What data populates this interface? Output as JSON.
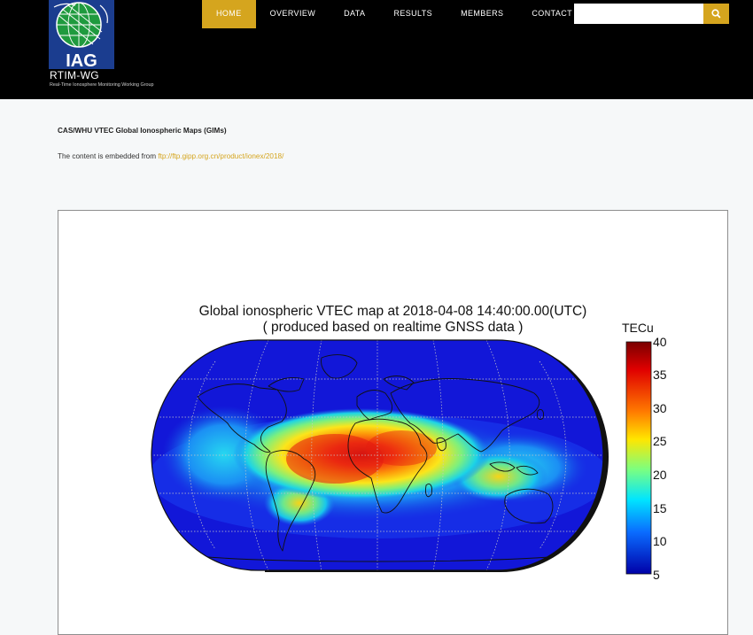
{
  "header": {
    "logo_text": "IAG",
    "site_name": "RTIM-WG",
    "tagline": "Real-Time Ionosphere Monitoring Working Group",
    "nav": [
      {
        "label": "HOME",
        "active": true
      },
      {
        "label": "OVERVIEW",
        "active": false
      },
      {
        "label": "DATA",
        "active": false
      },
      {
        "label": "RESULTS",
        "active": false
      },
      {
        "label": "MEMBERS",
        "active": false
      },
      {
        "label": "CONTACT",
        "active": false
      }
    ],
    "search": {
      "value": "",
      "icon": "search-icon"
    }
  },
  "content": {
    "heading": "CAS/WHU VTEC Global Ionospheric Maps (GIMs)",
    "embed_prefix": "The content is embedded from ",
    "embed_link": "ftp://ftp.gipp.org.cn/product/ionex/2018/"
  },
  "map": {
    "title_line1": "Global ionospheric VTEC map at 2018-04-08 14:40:00.00(UTC)",
    "title_line2": "( produced based on realtime GNSS data )",
    "colorbar": {
      "unit": "TECu",
      "ticks": [
        "40",
        "35",
        "30",
        "25",
        "20",
        "15",
        "10",
        "5"
      ],
      "min": 5,
      "max": 40
    }
  },
  "colors": {
    "header_bg": "#000000",
    "accent": "#d5a51e",
    "page_bg": "#f6f8f9",
    "link": "#d5a51e"
  }
}
